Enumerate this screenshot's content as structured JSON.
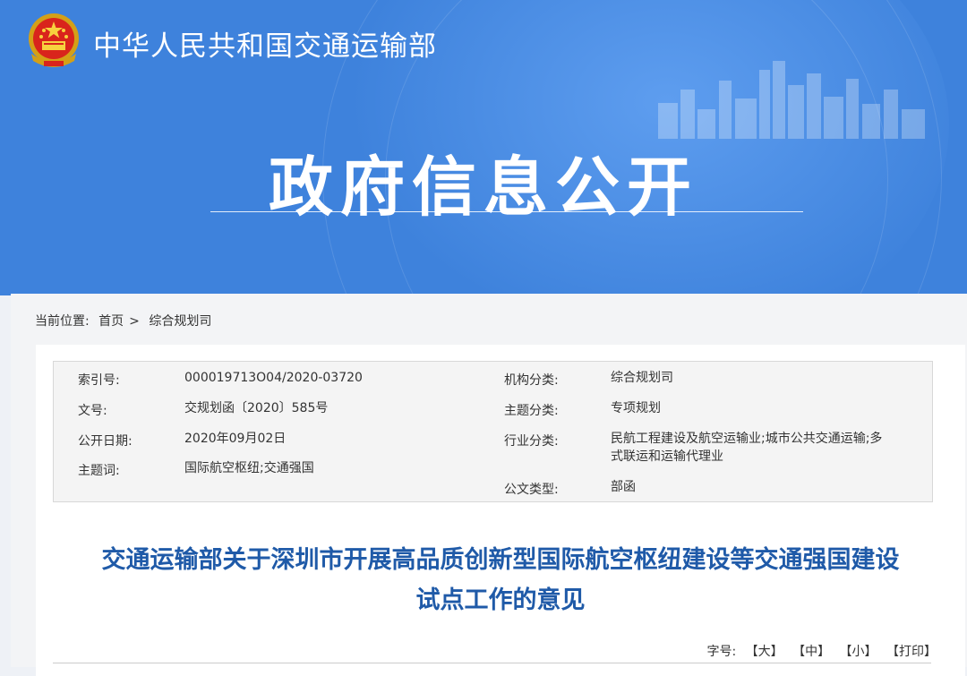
{
  "header": {
    "site_title": "中华人民共和国交通运输部",
    "hero_title": "政府信息公开"
  },
  "breadcrumb": {
    "prefix": "当前位置:",
    "home": "首页",
    "separator": ">",
    "current": "综合规划司"
  },
  "meta": {
    "index_label": "索引号:",
    "index_value": "000019713O04/2020-03720",
    "org_label": "机构分类:",
    "org_value": "综合规划司",
    "docno_label": "文号:",
    "docno_value": "交规划函〔2020〕585号",
    "topic_label": "主题分类:",
    "topic_value": "专项规划",
    "date_label": "公开日期:",
    "date_value": "2020年09月02日",
    "industry_label": "行业分类:",
    "industry_value_1": "民航工程建设及航空运输业;城市公共交通运输;多",
    "industry_value_2": "式联运和运输代理业",
    "keyword_label": "主题词:",
    "keyword_value": "国际航空枢纽;交通强国",
    "doctype_label": "公文类型:",
    "doctype_value": "部函"
  },
  "document": {
    "title_line1": "交通运输部关于深圳市开展高品质创新型国际航空枢纽建设等交通强国建设",
    "title_line2": "试点工作的意见"
  },
  "font_size": {
    "label": "字号:",
    "large": "【大】",
    "medium": "【中】",
    "small": "【小】",
    "print": "【打印】"
  },
  "colors": {
    "banner": "#3e82dc",
    "title_blue": "#1f5aa8"
  }
}
